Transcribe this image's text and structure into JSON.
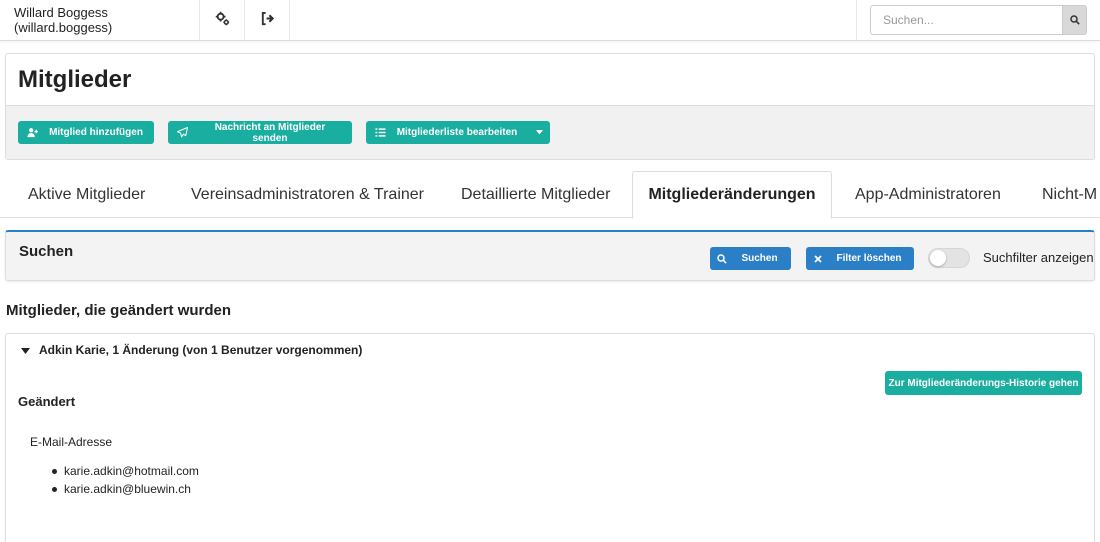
{
  "topbar": {
    "user_label": "Willard Boggess (willard.boggess)",
    "icons": [
      "gears-icon",
      "sign-out-icon"
    ],
    "search_placeholder": "Suchen..."
  },
  "page": {
    "title": "Mitglieder",
    "actions": [
      {
        "label": "Mitglied hinzufügen",
        "icon": "user-plus-icon"
      },
      {
        "label": "Nachricht an Mitglieder senden",
        "icon": "paper-plane-icon"
      },
      {
        "label": "Mitgliederliste bearbeiten",
        "icon": "list-icon",
        "dropdown": true
      }
    ]
  },
  "tabs": [
    {
      "label": "Aktive Mitglieder",
      "active": false
    },
    {
      "label": "Vereinsadministratoren & Trainer",
      "active": false
    },
    {
      "label": "Detaillierte Mitglieder",
      "active": false
    },
    {
      "label": "Mitgliederänderungen",
      "active": true
    },
    {
      "label": "App-Administratoren",
      "active": false
    },
    {
      "label": "Nicht-M",
      "active": false
    }
  ],
  "search_panel": {
    "title": "Suchen",
    "search_label": "Suchen",
    "clear_label": "Filter löschen",
    "toggle_label": "Suchfilter anzeigen",
    "toggle_on": false
  },
  "changes": {
    "section_title": "Mitglieder, die geändert wurden",
    "entry_title": "Adkin Karie, 1 Änderung (von 1 Benutzer vorgenommen)",
    "history_button": "Zur Mitgliederänderungs-Historie gehen",
    "status": "Geändert",
    "field": "E-Mail-Adresse",
    "values": [
      "karie.adkin@hotmail.com",
      "karie.adkin@bluewin.ch"
    ]
  },
  "colors": {
    "teal": "#1aaea0",
    "blue": "#2a7fc7"
  }
}
